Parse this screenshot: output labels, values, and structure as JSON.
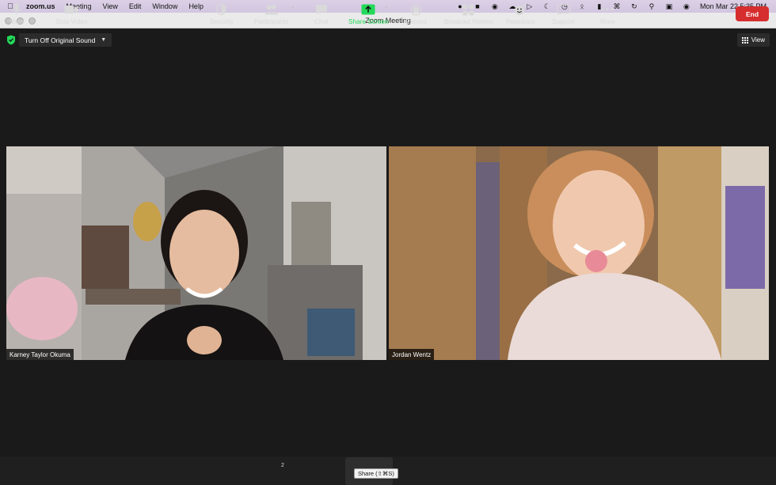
{
  "menubar": {
    "app": "zoom.us",
    "items": [
      "Meeting",
      "View",
      "Edit",
      "Window",
      "Help"
    ],
    "clock": "Mon Mar 22  5:35 PM"
  },
  "window": {
    "title": "Zoom Meeting"
  },
  "meeting": {
    "sound_button": "Turn Off Original Sound",
    "view_button": "View",
    "participants": [
      {
        "name": "Karney Taylor Okuma"
      },
      {
        "name": "Jordan Wentz"
      }
    ]
  },
  "toolbar": {
    "mute": "Mute",
    "stop_video": "Stop Video",
    "security": "Security",
    "participants": "Participants",
    "participant_count": "2",
    "chat": "Chat",
    "share_screen": "Share Screen",
    "share_tooltip": "Share (⇧⌘S)",
    "record": "Record",
    "breakout_rooms": "Breakout Rooms",
    "reactions": "Reactions",
    "support": "Support",
    "more": "More",
    "end": "End"
  },
  "colors": {
    "end": "#d62e2e",
    "share": "#23d959",
    "shield": "#23d959"
  }
}
